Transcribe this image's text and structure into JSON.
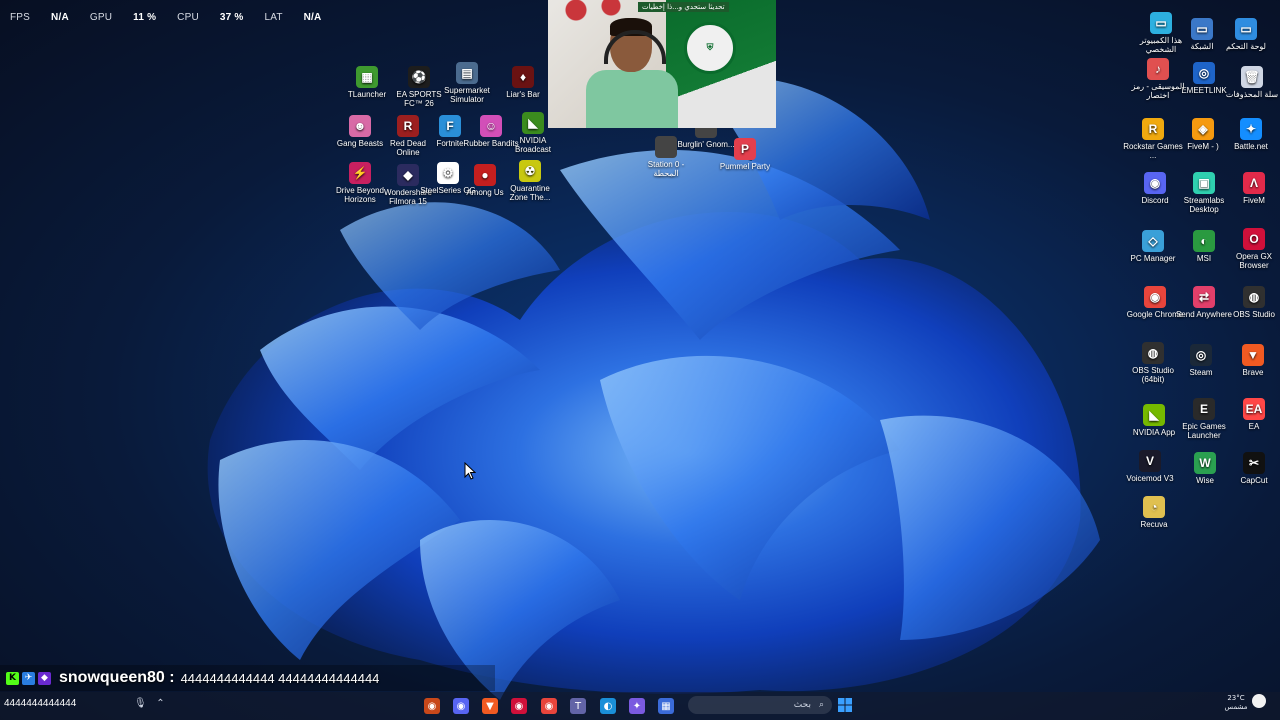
{
  "perf": [
    {
      "label": "FPS",
      "value": "N/A"
    },
    {
      "label": "GPU",
      "value": "11 %"
    },
    {
      "label": "CPU",
      "value": "37 %"
    },
    {
      "label": "LAT",
      "value": "N/A"
    }
  ],
  "desktop_icons_left": [
    {
      "name": "tlauncher-icon",
      "label": "TLauncher",
      "color": "#3f9a2f",
      "glyph": "▦"
    },
    {
      "name": "ea-sports-fc-icon",
      "label": "EA SPORTS FC™ 26",
      "color": "#1d1d1d",
      "glyph": "⚽"
    },
    {
      "name": "supermarket-simulator-icon",
      "label": "Supermarket Simulator",
      "color": "#4b6b8f",
      "glyph": "▤"
    },
    {
      "name": "liars-bar-icon",
      "label": "Liar's Bar",
      "color": "#6a1212",
      "glyph": "♦"
    },
    {
      "name": "gang-beasts-icon",
      "label": "Gang Beasts",
      "color": "#d86aa6",
      "glyph": "☻"
    },
    {
      "name": "red-dead-online-icon",
      "label": "Red Dead Online",
      "color": "#9c1f1f",
      "glyph": "R"
    },
    {
      "name": "fortnite-icon",
      "label": "Fortnite",
      "color": "#2a8fd8",
      "glyph": "F"
    },
    {
      "name": "rubber-bandits-icon",
      "label": "Rubber Bandits",
      "color": "#d24fb8",
      "glyph": "☺"
    },
    {
      "name": "nvidia-broadcast-icon",
      "label": "NVIDIA Broadcast",
      "color": "#3b8c1e",
      "glyph": "◣"
    },
    {
      "name": "drive-beyond-horizons-icon",
      "label": "Drive Beyond Horizons",
      "color": "#c82060",
      "glyph": "⚡"
    },
    {
      "name": "wondershare-filmora-icon",
      "label": "Wondershare Filmora 15",
      "color": "#2b2b5f",
      "glyph": "◆"
    },
    {
      "name": "steelseries-gg-icon",
      "label": "SteelSeries GG",
      "color": "#ffffff",
      "glyph": "⚙"
    },
    {
      "name": "among-us-icon",
      "label": "Among Us",
      "color": "#c41f1f",
      "glyph": "●"
    },
    {
      "name": "quarantine-zone-icon",
      "label": "Quarantine Zone The...",
      "color": "#c8c810",
      "glyph": "☢"
    }
  ],
  "desktop_icons_mid": [
    {
      "name": "burglin-gnomes-icon",
      "label": "Burglin' Gnom..."
    },
    {
      "name": "station-0-icon",
      "label": "Station 0 - المحطة"
    },
    {
      "name": "pummel-party-icon",
      "label": "Pummel Party",
      "color": "#e33f4d",
      "glyph": "P"
    }
  ],
  "desktop_icons_right": [
    {
      "name": "control-panel-icon",
      "label": "لوحة التحكم",
      "color": "#2f8de0",
      "glyph": "▭"
    },
    {
      "name": "network-icon",
      "label": "الشبكة",
      "color": "#3b78c8",
      "glyph": "▭"
    },
    {
      "name": "this-pc-icon",
      "label": "هذا الكمبيوتر الشخصي",
      "color": "#2db0e0",
      "glyph": "▭"
    },
    {
      "name": "recycle-bin-icon",
      "label": "سلة المحذوفات",
      "color": "#cfd6e4",
      "glyph": "🗑"
    },
    {
      "name": "emeetlink-icon",
      "label": "EMEETLINK",
      "color": "#1e64c8",
      "glyph": "◎"
    },
    {
      "name": "music-shortcut-icon",
      "label": "الموسيقى - رمز اختصار",
      "color": "#e05050",
      "glyph": "♪"
    },
    {
      "name": "battlenet-icon",
      "label": "Battle.net",
      "color": "#148eff",
      "glyph": "✦"
    },
    {
      "name": "fivem-minus-icon",
      "label": "FiveM - )",
      "color": "#f59a10",
      "glyph": "◈"
    },
    {
      "name": "rockstar-games-icon",
      "label": "Rockstar Games ...",
      "color": "#f0a90f",
      "glyph": "R"
    },
    {
      "name": "fivem-icon",
      "label": "FiveM",
      "color": "#e22a4a",
      "glyph": "Λ"
    },
    {
      "name": "streamlabs-desktop-icon",
      "label": "Streamlabs Desktop",
      "color": "#2fd0b0",
      "glyph": "▣"
    },
    {
      "name": "discord-icon",
      "label": "Discord",
      "color": "#5865f2",
      "glyph": "◉"
    },
    {
      "name": "opera-gx-icon",
      "label": "Opera GX Browser",
      "color": "#d0103a",
      "glyph": "O"
    },
    {
      "name": "msi-icon",
      "label": "MSI",
      "color": "#2a9a40",
      "glyph": "◐"
    },
    {
      "name": "pc-manager-icon",
      "label": "PC Manager",
      "color": "#3aa0d8",
      "glyph": "◇"
    },
    {
      "name": "obs-studio-icon",
      "label": "OBS Studio",
      "color": "#303030",
      "glyph": "◍"
    },
    {
      "name": "send-anywhere-icon",
      "label": "Send Anywhere",
      "color": "#e23f6a",
      "glyph": "⇄"
    },
    {
      "name": "google-chrome-icon",
      "label": "Google Chrome",
      "color": "#e8453c",
      "glyph": "◉"
    },
    {
      "name": "brave-icon",
      "label": "Brave",
      "color": "#f15a22",
      "glyph": "▼"
    },
    {
      "name": "steam-icon",
      "label": "Steam",
      "color": "#1b2838",
      "glyph": "◎"
    },
    {
      "name": "obs-studio-64-icon",
      "label": "OBS Studio (64bit)",
      "color": "#303030",
      "glyph": "◍"
    },
    {
      "name": "ea-icon",
      "label": "EA",
      "color": "#ff4747",
      "glyph": "EA"
    },
    {
      "name": "epic-games-launcher-icon",
      "label": "Epic Games Launcher",
      "color": "#2a2a2a",
      "glyph": "E"
    },
    {
      "name": "nvidia-app-icon",
      "label": "NVIDIA App",
      "color": "#76b900",
      "glyph": "◣"
    },
    {
      "name": "capcut-icon",
      "label": "CapCut",
      "color": "#111111",
      "glyph": "✂"
    },
    {
      "name": "wise-icon",
      "label": "Wise",
      "color": "#2aa050",
      "glyph": "W"
    },
    {
      "name": "voicemod-icon",
      "label": "Voicemod V3",
      "color": "#1a1a2a",
      "glyph": "V"
    },
    {
      "name": "recuva-icon",
      "label": "Recuva",
      "color": "#e0c050",
      "glyph": "◔"
    }
  ],
  "webcam": {
    "banner": "تحديثا ستحدي و...ذا إخطيات"
  },
  "chat": {
    "user": "snowqueen80 :",
    "message": "4444444444444 44444444444444"
  },
  "taskbar": {
    "left_text": "4444444444444",
    "search_placeholder": "بحث",
    "weather_temp": "23°C",
    "weather_text": "مشمس"
  },
  "taskbar_apps": [
    {
      "name": "taskbar-app-1",
      "color": "#c8481a",
      "glyph": "◉"
    },
    {
      "name": "taskbar-discord",
      "color": "#5865f2",
      "glyph": "◉"
    },
    {
      "name": "taskbar-brave",
      "color": "#f15a22",
      "glyph": "▼"
    },
    {
      "name": "taskbar-app-4",
      "color": "#d0103a",
      "glyph": "◉"
    },
    {
      "name": "taskbar-chrome",
      "color": "#e8453c",
      "glyph": "◉"
    },
    {
      "name": "taskbar-teams",
      "color": "#6264a7",
      "glyph": "T"
    },
    {
      "name": "taskbar-edge",
      "color": "#1a8fd8",
      "glyph": "◐"
    },
    {
      "name": "taskbar-copilot",
      "color": "#7a5ae0",
      "glyph": "✦"
    },
    {
      "name": "taskbar-store",
      "color": "#3b6bd8",
      "glyph": "▦"
    }
  ]
}
